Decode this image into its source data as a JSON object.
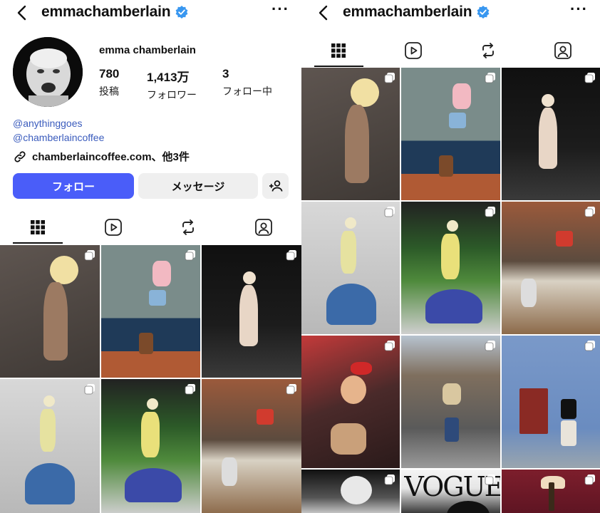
{
  "left_screen": {
    "header": {
      "username": "emmachamberlain"
    },
    "profile": {
      "display_name": "emma chamberlain",
      "stats": [
        {
          "value": "780",
          "label": "投稿"
        },
        {
          "value": "1,413万",
          "label": "フォロワー"
        },
        {
          "value": "3",
          "label": "フォロー中"
        }
      ],
      "links": [
        "@anythinggoes",
        "@chamberlaincoffee"
      ],
      "website": "chamberlaincoffee.com、他3件"
    },
    "buttons": {
      "follow": "フォロー",
      "message": "メッセージ"
    }
  },
  "right_screen": {
    "header": {
      "username": "emmachamberlain"
    }
  },
  "grid_extra": {
    "vogue_text": "VOGUE"
  },
  "colors": {
    "accent": "#4a5df9",
    "verified": "#3897f0",
    "link": "#3b5cbd",
    "secondary_button": "#efefef"
  },
  "icons": [
    "back-arrow-icon",
    "verified-badge-icon",
    "more-options-icon",
    "grid-icon",
    "reels-icon",
    "reposts-icon",
    "tagged-icon",
    "add-person-icon",
    "link-icon",
    "multi-photo-icon"
  ]
}
